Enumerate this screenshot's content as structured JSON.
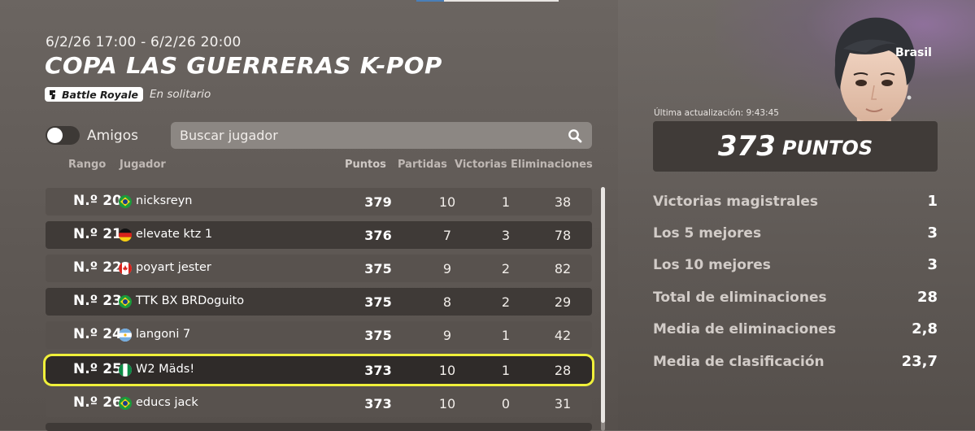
{
  "event": {
    "date_range": "6/2/26 17:00 - 6/2/26 20:00",
    "title": "COPA LAS GUERRERAS K-POP",
    "mode_badge": "Battle Royale",
    "mode_sub": "En solitario"
  },
  "filters": {
    "friends_label": "Amigos",
    "friends_toggle_on": false,
    "search_placeholder": "Buscar jugador",
    "search_icon": "search-icon"
  },
  "table": {
    "columns": {
      "rank": "Rango",
      "player": "Jugador",
      "points": "Puntos",
      "matches": "Partidas",
      "wins": "Victorias",
      "eliminations": "Eliminaciones"
    },
    "rows": [
      {
        "rank": "N.º 20",
        "flag": "brazil",
        "name": "nicksreyn",
        "points": "379",
        "matches": "10",
        "wins": "1",
        "eliminations": "38"
      },
      {
        "rank": "N.º 21",
        "flag": "germany",
        "name": "elevate ktz 1",
        "points": "376",
        "matches": "7",
        "wins": "3",
        "eliminations": "78"
      },
      {
        "rank": "N.º 22",
        "flag": "canada",
        "name": "poyart jester",
        "points": "375",
        "matches": "9",
        "wins": "2",
        "eliminations": "82"
      },
      {
        "rank": "N.º 23",
        "flag": "brazil",
        "name": "TTK BX BRDoguito",
        "points": "375",
        "matches": "8",
        "wins": "2",
        "eliminations": "29"
      },
      {
        "rank": "N.º 24",
        "flag": "argentina",
        "name": "langoni 7",
        "points": "375",
        "matches": "9",
        "wins": "1",
        "eliminations": "42"
      },
      {
        "rank": "N.º 25",
        "flag": "nigeria",
        "name": "W2 Mäds!",
        "points": "373",
        "matches": "10",
        "wins": "1",
        "eliminations": "28",
        "highlighted": true
      },
      {
        "rank": "N.º 26",
        "flag": "brazil",
        "name": "educs jack",
        "points": "373",
        "matches": "10",
        "wins": "0",
        "eliminations": "31"
      }
    ]
  },
  "profile": {
    "region": "Brasil",
    "last_updated": "Última actualización: 9:43:45",
    "points_value": "373",
    "points_label": "PUNTOS",
    "stats": [
      {
        "label": "Victorias magistrales",
        "value": "1"
      },
      {
        "label": "Los 5 mejores",
        "value": "3"
      },
      {
        "label": "Los 10 mejores",
        "value": "3"
      },
      {
        "label": "Total de eliminaciones",
        "value": "28"
      },
      {
        "label": "Media de eliminaciones",
        "value": "2,8"
      },
      {
        "label": "Media de clasificación",
        "value": "23,7"
      }
    ]
  },
  "colors": {
    "highlight_border": "#f0f03a",
    "row_light": "#58524e",
    "row_dark": "#3f3a37"
  }
}
